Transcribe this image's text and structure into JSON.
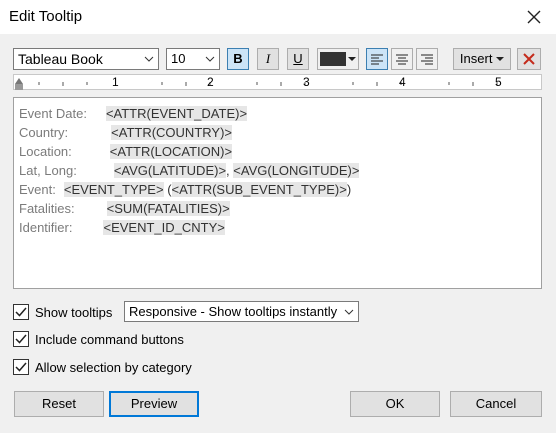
{
  "window": {
    "title": "Edit Tooltip"
  },
  "toolbar": {
    "font": "Tableau Book",
    "size": "10",
    "bold": "B",
    "italic": "I",
    "underline": "U",
    "color": "#333333",
    "insert": "Insert",
    "ruler_numbers": [
      "1",
      "2",
      "3",
      "4",
      "5"
    ]
  },
  "editor": {
    "lines": [
      {
        "label": "Event Date:",
        "parts": [
          "<ATTR(EVENT_DATE)>"
        ]
      },
      {
        "label": "Country:",
        "parts": [
          "<ATTR(COUNTRY)>"
        ]
      },
      {
        "label": "Location:",
        "parts": [
          "<ATTR(LOCATION)>"
        ]
      },
      {
        "label": "Lat, Long:",
        "parts": [
          "<AVG(LATITUDE)>",
          ", ",
          "<AVG(LONGITUDE)>"
        ]
      },
      {
        "label": "Event:",
        "parts": [
          "<EVENT_TYPE>",
          " (",
          "<ATTR(SUB_EVENT_TYPE)>",
          ")"
        ]
      },
      {
        "label": "Fatalities:",
        "parts": [
          "<SUM(FATALITIES)>"
        ]
      },
      {
        "label": "Identifier:",
        "parts": [
          "<EVENT_ID_CNTY>"
        ]
      }
    ]
  },
  "options": {
    "show_tooltips": "Show tooltips",
    "tooltip_mode": "Responsive - Show tooltips instantly",
    "include_command_buttons": "Include command buttons",
    "allow_selection": "Allow selection by category"
  },
  "buttons": {
    "reset": "Reset",
    "preview": "Preview",
    "ok": "OK",
    "cancel": "Cancel"
  }
}
